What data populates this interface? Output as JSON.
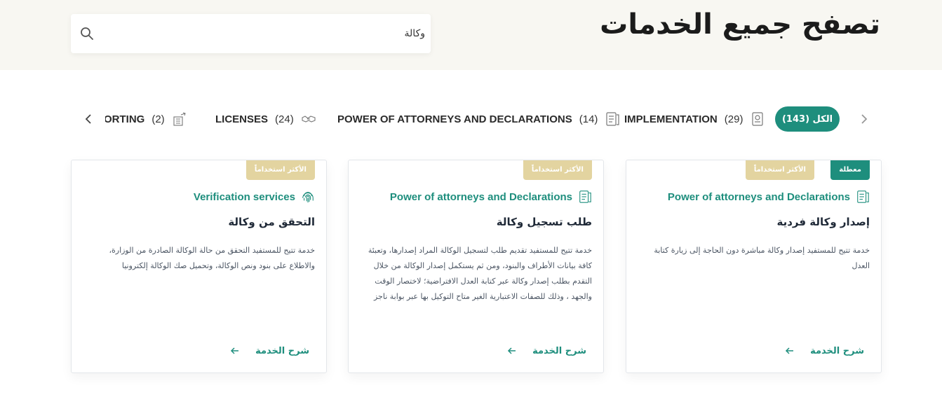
{
  "header": {
    "title": "تصفح جميع الخدمات",
    "search_value": "وكالة",
    "search_icon": "search-icon"
  },
  "tabs": {
    "active": {
      "label": "الكل (143)"
    },
    "items": [
      {
        "label": "IMPLEMENTATION",
        "count": "(29)",
        "icon": "badge-document-icon"
      },
      {
        "label": "POWER OF ATTORNEYS AND DECLARATIONS",
        "count": "(14)",
        "icon": "document-lines-icon"
      },
      {
        "label": "LICENSES",
        "count": "(24)",
        "icon": "handshake-icon"
      },
      {
        "label": "PORTING",
        "count": "(2)",
        "icon": "building-arrows-icon"
      }
    ]
  },
  "cards": [
    {
      "badge_popular": "الأكثر استخداماً",
      "badge_disabled": "معطلة",
      "category": "Power of attorneys and Declarations",
      "category_icon": "document-lines-icon",
      "title": "إصدار وكالة فردية",
      "description": "خدمة تتيح للمستفيد إصدار وكالة مباشرة دون الحاجة إلى زيارة كتابة العدل",
      "link": "شرح الخدمة"
    },
    {
      "badge_popular": "الأكثر استخداماً",
      "category": "Power of attorneys and Declarations",
      "category_icon": "document-lines-icon",
      "title": "طلب تسجيل وكالة",
      "description": "خدمة تتيح للمستفيد تقديم طلب لتسجيل الوكالة المراد إصدارها، وتعبئة كافة بيانات الأطراف والبنود، ومن ثم يستكمل إصدار الوكالة من خلال التقدم بطلب إصدار وكالة عبر كتابة العدل الافتراضية؛ لاختصار الوقت والجهد ، وذلك للصفات الاعتبارية الغير متاح التوكيل بها عبر بوابة ناجز",
      "link": "شرح الخدمة"
    },
    {
      "badge_popular": "الأكثر استخداماً",
      "category": "Verification services",
      "category_icon": "fingerprint-icon",
      "title": "التحقق من وكالة",
      "description": "خدمة تتيح للمستفيد التحقق من حالة الوكالة الصادرة من الوزارة، والاطلاع على بنود ونص الوكالة، وتحميل صك الوكالة إلكترونيا",
      "link": "شرح الخدمة"
    }
  ],
  "colors": {
    "accent": "#1e8e7d",
    "badge_gold": "#e3d4a0",
    "header_bg": "#f8f7f2"
  }
}
